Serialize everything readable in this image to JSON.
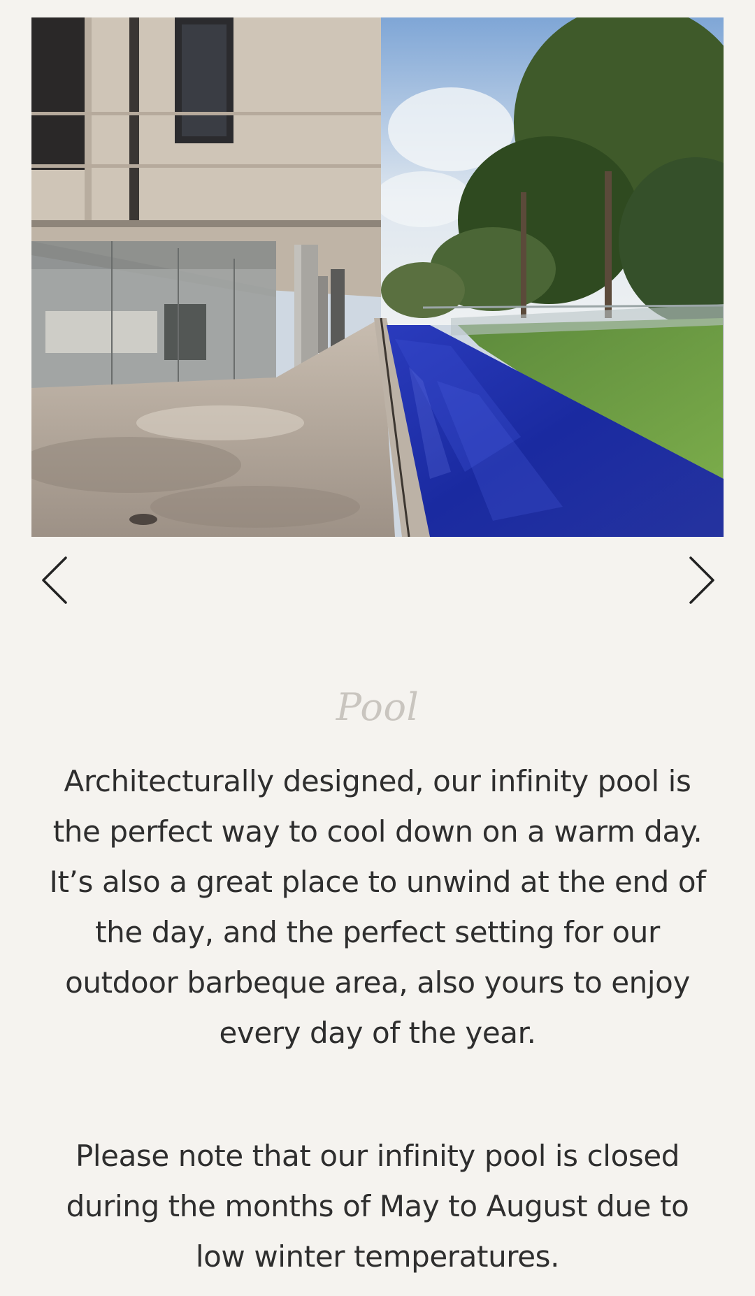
{
  "gallery": {
    "image_alt": "Infinity pool beside modern building",
    "prev_icon": "chevron-left-icon",
    "next_icon": "chevron-right-icon"
  },
  "section": {
    "title": "Pool",
    "paragraphs": [
      "Architecturally designed, our infinity pool is the perfect way to cool down on a warm day. It’s also a great place to unwind at the end of the day, and the perfect setting for our outdoor barbeque area, also yours to enjoy every day of the year.",
      "Please note that our infinity pool is closed during the months of May to August due to low winter temperatures."
    ]
  },
  "colors": {
    "page_background": "#f5f3ef",
    "title": "#c9c5bf",
    "body_text": "#2e2e2e",
    "pool_water": "#1f2ea8"
  }
}
